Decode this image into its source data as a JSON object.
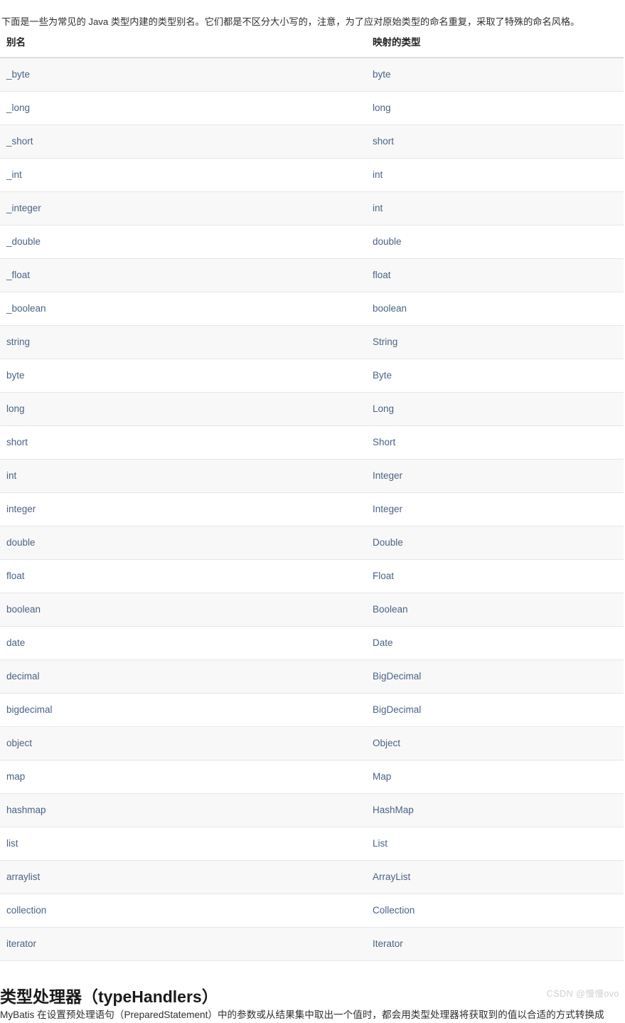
{
  "intro": {
    "text": "下面是一些为常见的 Java 类型内建的类型别名。它们都是不区分大小写的，注意，为了应对原始类型的命名重复，采取了特殊的命名风格。"
  },
  "table": {
    "columns": [
      "别名",
      "映射的类型"
    ],
    "rows": [
      [
        "_byte",
        "byte"
      ],
      [
        "_long",
        "long"
      ],
      [
        "_short",
        "short"
      ],
      [
        "_int",
        "int"
      ],
      [
        "_integer",
        "int"
      ],
      [
        "_double",
        "double"
      ],
      [
        "_float",
        "float"
      ],
      [
        "_boolean",
        "boolean"
      ],
      [
        "string",
        "String"
      ],
      [
        "byte",
        "Byte"
      ],
      [
        "long",
        "Long"
      ],
      [
        "short",
        "Short"
      ],
      [
        "int",
        "Integer"
      ],
      [
        "integer",
        "Integer"
      ],
      [
        "double",
        "Double"
      ],
      [
        "float",
        "Float"
      ],
      [
        "boolean",
        "Boolean"
      ],
      [
        "date",
        "Date"
      ],
      [
        "decimal",
        "BigDecimal"
      ],
      [
        "bigdecimal",
        "BigDecimal"
      ],
      [
        "object",
        "Object"
      ],
      [
        "map",
        "Map"
      ],
      [
        "hashmap",
        "HashMap"
      ],
      [
        "list",
        "List"
      ],
      [
        "arraylist",
        "ArrayList"
      ],
      [
        "collection",
        "Collection"
      ],
      [
        "iterator",
        "Iterator"
      ]
    ]
  },
  "section": {
    "heading": "类型处理器（typeHandlers）",
    "paragraph": "MyBatis 在设置预处理语句（PreparedStatement）中的参数或从结果集中取出一个值时，都会用类型处理器将获取到的值以合适的方式转换成"
  },
  "watermark": {
    "text": "CSDN @慢慢ovo"
  },
  "colors": {
    "cell_text": "#4a6385",
    "header_text": "#1f1f1f",
    "body_text": "#2f2f2f",
    "row_stripe": "#f8f8f8",
    "row_border": "#e6e6e6",
    "header_border": "#dcdcdc",
    "watermark": "#cfcfcf"
  }
}
